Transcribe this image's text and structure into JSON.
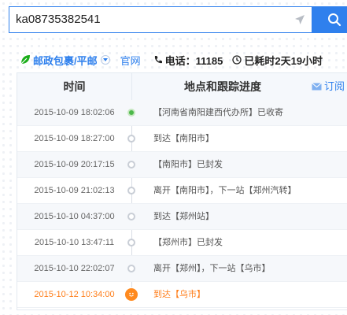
{
  "search": {
    "value": "ka08735382541"
  },
  "info": {
    "carrier_name": "邮政包裹/平邮",
    "official_label": "官网",
    "phone_label": "电话：11185",
    "elapsed_label": "已耗时2天19小时"
  },
  "table": {
    "col_time": "时间",
    "col_location": "地点和跟踪进度",
    "subscribe_label": "订阅"
  },
  "rows": [
    {
      "time": "2015-10-09 18:02:06",
      "location": "【河南省南阳建西代办所】已收寄",
      "status": "first"
    },
    {
      "time": "2015-10-09 18:27:00",
      "location": "到达【南阳市】",
      "status": "normal"
    },
    {
      "time": "2015-10-09 20:17:15",
      "location": "【南阳市】已封发",
      "status": "normal"
    },
    {
      "time": "2015-10-09 21:02:13",
      "location": "离开【南阳市】，下一站【郑州汽转】",
      "status": "normal"
    },
    {
      "time": "2015-10-10 04:37:00",
      "location": "到达【郑州站】",
      "status": "normal"
    },
    {
      "time": "2015-10-10 13:47:11",
      "location": "【郑州市】已封发",
      "status": "normal"
    },
    {
      "time": "2015-10-10 22:02:07",
      "location": "离开【郑州】，下一站【乌市】",
      "status": "normal"
    },
    {
      "time": "2015-10-12 10:34:00",
      "location": "到达【乌市】",
      "status": "latest"
    }
  ],
  "colors": {
    "accent": "#2f80ed",
    "latest": "#ff7e1a",
    "received": "#4cb84a",
    "carrier_leaf": "#1aad19"
  },
  "icons": {
    "search_button": "search-icon",
    "input_action": "send-arrow-icon",
    "carrier": "leaf-icon",
    "phone": "phone-icon",
    "elapsed": "clock-icon",
    "subscribe": "mail-icon",
    "latest_node": "smile-icon"
  }
}
